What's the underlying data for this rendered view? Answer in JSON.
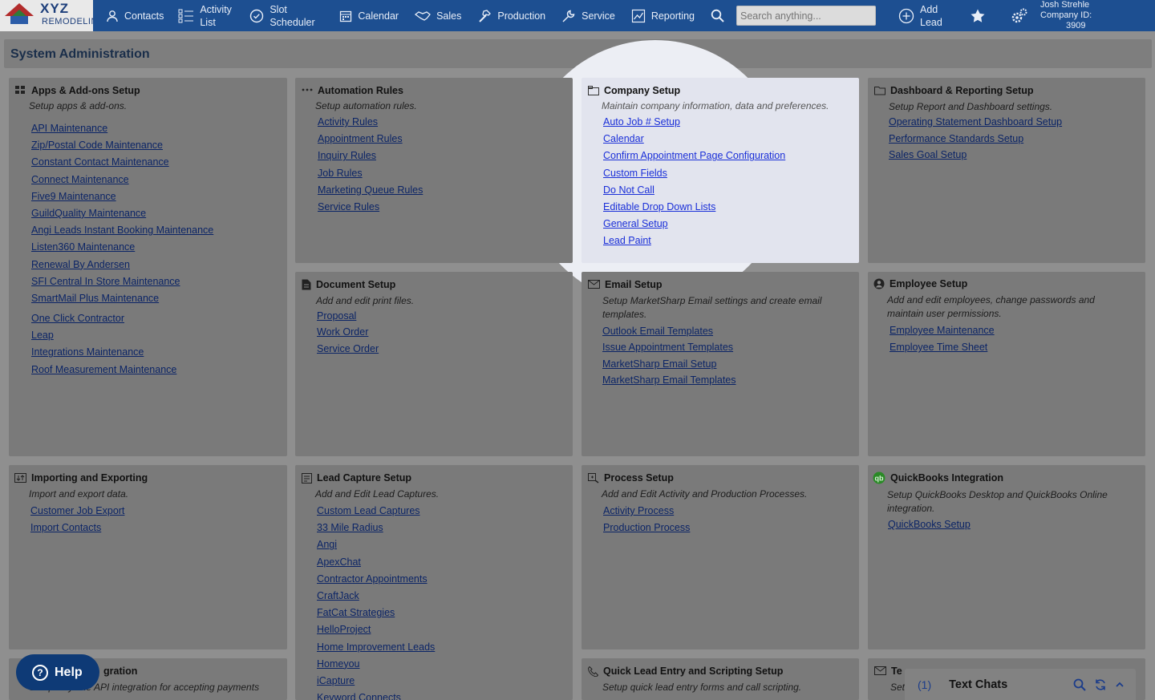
{
  "brand": {
    "name": "XYZ",
    "sub": "REMODELING"
  },
  "nav": [
    {
      "label": "Contacts",
      "icon": "person-icon"
    },
    {
      "label": "Activity List",
      "icon": "list-icon"
    },
    {
      "label": "Slot Scheduler",
      "icon": "clock-check-icon"
    },
    {
      "label": "Calendar",
      "icon": "calendar-icon"
    },
    {
      "label": "Sales",
      "icon": "handshake-icon"
    },
    {
      "label": "Production",
      "icon": "hammer-icon"
    },
    {
      "label": "Service",
      "icon": "wrench-icon"
    },
    {
      "label": "Reporting",
      "icon": "chart-icon"
    }
  ],
  "search": {
    "placeholder": "Search anything..."
  },
  "add_lead": "Add Lead",
  "user": {
    "name": "Josh Strehle",
    "company": "Company ID:",
    "company_id": "3909"
  },
  "page_title": "System Administration",
  "panels": {
    "apps": {
      "title": "Apps & Add-ons Setup",
      "desc": "Setup apps & add-ons.",
      "links": [
        "API Maintenance",
        "Zip/Postal Code Maintenance",
        "Constant Contact Maintenance",
        "Connect Maintenance",
        "Five9 Maintenance",
        "GuildQuality Maintenance",
        "Angi Leads Instant Booking Maintenance",
        "Listen360 Maintenance",
        "Renewal By Andersen",
        "SFI Central In Store Maintenance",
        "SmartMail Plus Maintenance",
        "One Click Contractor",
        "Leap",
        "Integrations Maintenance",
        "Roof Measurement Maintenance"
      ]
    },
    "automation": {
      "title": "Automation Rules",
      "desc": "Setup automation rules.",
      "links": [
        "Activity Rules",
        "Appointment Rules",
        "Inquiry Rules",
        "Job Rules",
        "Marketing Queue Rules",
        "Service Rules"
      ]
    },
    "company": {
      "title": "Company Setup",
      "desc": "Maintain company information, data and preferences.",
      "links": [
        "Auto Job # Setup",
        "Calendar",
        "Confirm Appointment Page Configuration",
        "Custom Fields",
        "Do Not Call",
        "Editable Drop Down Lists",
        "General Setup",
        "Lead Paint"
      ]
    },
    "dashboard": {
      "title": "Dashboard & Reporting Setup",
      "desc": "Setup Report and Dashboard settings.",
      "links": [
        "Operating Statement Dashboard Setup",
        "Performance Standards Setup",
        "Sales Goal Setup"
      ]
    },
    "document": {
      "title": "Document Setup",
      "desc": "Add and edit print files.",
      "links": [
        "Proposal",
        "Work Order",
        "Service Order"
      ]
    },
    "email": {
      "title": "Email Setup",
      "desc": "Setup MarketSharp Email settings and create email templates.",
      "links": [
        "Outlook Email Templates",
        "Issue Appointment Templates",
        "MarketSharp Email Setup",
        "MarketSharp Email Templates"
      ]
    },
    "employee": {
      "title": "Employee Setup",
      "desc": "Add and edit employees, change passwords and maintain user permissions.",
      "links": [
        "Employee Maintenance",
        "Employee Time Sheet"
      ]
    },
    "importing": {
      "title": "Importing and Exporting",
      "desc": "Import and export data.",
      "links": [
        "Customer Job Export",
        "Import Contacts"
      ]
    },
    "leadcapture": {
      "title": "Lead Capture Setup",
      "desc": "Add and Edit Lead Captures.",
      "links": [
        "Custom Lead Captures",
        "33 Mile Radius",
        "Angi",
        "ApexChat",
        "Contractor Appointments",
        "CraftJack",
        "FatCat Strategies",
        "HelloProject",
        "Home Improvement Leads",
        "Homeyou",
        "iCapture",
        "Keyword Connects"
      ]
    },
    "process": {
      "title": "Process Setup",
      "desc": "Add and Edit Activity and Production Processes.",
      "links": [
        "Activity Process",
        "Production Process"
      ]
    },
    "quickbooks": {
      "title": "QuickBooks Integration",
      "desc": "Setup QuickBooks Desktop and QuickBooks Online integration.",
      "links": [
        "QuickBooks Setup"
      ]
    },
    "payments": {
      "title": "gration",
      "desc": "Setup Payable API integration for accepting payments"
    },
    "quicklead": {
      "title": "Quick Lead Entry and Scripting Setup",
      "desc": "Setup quick lead entry forms and call scripting."
    },
    "text": {
      "title": "Te",
      "desc": "Set"
    }
  },
  "help": "Help",
  "chat": {
    "count": "(1)",
    "label": "Text Chats"
  }
}
